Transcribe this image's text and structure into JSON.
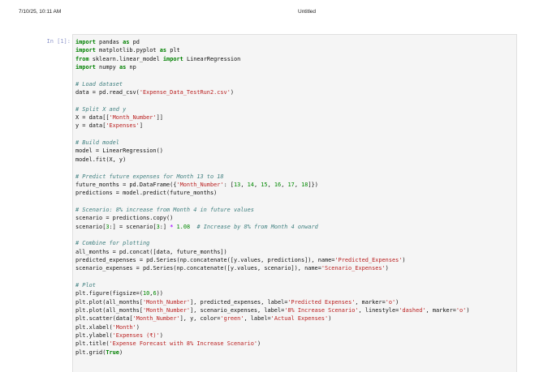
{
  "print_header": {
    "date": "7/10/25, 10:11 AM",
    "title": "Untitled"
  },
  "cell": {
    "prompt": "In [1]:",
    "language": "python",
    "lines": [
      [
        {
          "t": "import",
          "c": "kw"
        },
        {
          "t": " pandas "
        },
        {
          "t": "as",
          "c": "kw"
        },
        {
          "t": " pd"
        }
      ],
      [
        {
          "t": "import",
          "c": "kw"
        },
        {
          "t": " matplotlib.pyplot "
        },
        {
          "t": "as",
          "c": "kw"
        },
        {
          "t": " plt"
        }
      ],
      [
        {
          "t": "from",
          "c": "kw"
        },
        {
          "t": " sklearn.linear_model "
        },
        {
          "t": "import",
          "c": "kw"
        },
        {
          "t": " LinearRegression"
        }
      ],
      [
        {
          "t": "import",
          "c": "kw"
        },
        {
          "t": " numpy "
        },
        {
          "t": "as",
          "c": "kw"
        },
        {
          "t": " np"
        }
      ],
      [],
      [
        {
          "t": "# Load dataset",
          "c": "cm"
        }
      ],
      [
        {
          "t": "data = pd.read_csv("
        },
        {
          "t": "'Expense_Data_TestRun2.csv'",
          "c": "st"
        },
        {
          "t": ")"
        }
      ],
      [],
      [
        {
          "t": "# Split X and y",
          "c": "cm"
        }
      ],
      [
        {
          "t": "X = data[["
        },
        {
          "t": "'Month_Number'",
          "c": "st"
        },
        {
          "t": "]]"
        }
      ],
      [
        {
          "t": "y = data["
        },
        {
          "t": "'Expenses'",
          "c": "st"
        },
        {
          "t": "]"
        }
      ],
      [],
      [
        {
          "t": "# Build model",
          "c": "cm"
        }
      ],
      [
        {
          "t": "model = LinearRegression()"
        }
      ],
      [
        {
          "t": "model.fit(X, y)"
        }
      ],
      [],
      [
        {
          "t": "# Predict future expenses for Month 13 to 18",
          "c": "cm"
        }
      ],
      [
        {
          "t": "future_months = pd.DataFrame({"
        },
        {
          "t": "'Month_Number'",
          "c": "st"
        },
        {
          "t": ": ["
        },
        {
          "t": "13",
          "c": "nu"
        },
        {
          "t": ", "
        },
        {
          "t": "14",
          "c": "nu"
        },
        {
          "t": ", "
        },
        {
          "t": "15",
          "c": "nu"
        },
        {
          "t": ", "
        },
        {
          "t": "16",
          "c": "nu"
        },
        {
          "t": ", "
        },
        {
          "t": "17",
          "c": "nu"
        },
        {
          "t": ", "
        },
        {
          "t": "18",
          "c": "nu"
        },
        {
          "t": "]})"
        }
      ],
      [
        {
          "t": "predictions = model.predict(future_months)"
        }
      ],
      [],
      [
        {
          "t": "# Scenario: 8% increase from Month 4 in future values",
          "c": "cm"
        }
      ],
      [
        {
          "t": "scenario = predictions.copy()"
        }
      ],
      [
        {
          "t": "scenario["
        },
        {
          "t": "3",
          "c": "nu"
        },
        {
          "t": ":] = scenario["
        },
        {
          "t": "3",
          "c": "nu"
        },
        {
          "t": ":] "
        },
        {
          "t": "*",
          "c": "op"
        },
        {
          "t": " "
        },
        {
          "t": "1.08",
          "c": "nu"
        },
        {
          "t": "  "
        },
        {
          "t": "# Increase by 8% from Month 4 onward",
          "c": "cm"
        }
      ],
      [],
      [
        {
          "t": "# Combine for plotting",
          "c": "cm"
        }
      ],
      [
        {
          "t": "all_months = pd.concat([data, future_months])"
        }
      ],
      [
        {
          "t": "predicted_expenses = pd.Series(np.concatenate([y.values, predictions]), name="
        },
        {
          "t": "'Predicted_Expenses'",
          "c": "st"
        },
        {
          "t": ")"
        }
      ],
      [
        {
          "t": "scenario_expenses = pd.Series(np.concatenate([y.values, scenario]), name="
        },
        {
          "t": "'Scenario_Expenses'",
          "c": "st"
        },
        {
          "t": ")"
        }
      ],
      [],
      [
        {
          "t": "# Plot",
          "c": "cm"
        }
      ],
      [
        {
          "t": "plt.figure(figsize=("
        },
        {
          "t": "10",
          "c": "nu"
        },
        {
          "t": ","
        },
        {
          "t": "6",
          "c": "nu"
        },
        {
          "t": "))"
        }
      ],
      [
        {
          "t": "plt.plot(all_months["
        },
        {
          "t": "'Month_Number'",
          "c": "st"
        },
        {
          "t": "], predicted_expenses, label="
        },
        {
          "t": "'Predicted Expenses'",
          "c": "st"
        },
        {
          "t": ", marker="
        },
        {
          "t": "'o'",
          "c": "st"
        },
        {
          "t": ")"
        }
      ],
      [
        {
          "t": "plt.plot(all_months["
        },
        {
          "t": "'Month_Number'",
          "c": "st"
        },
        {
          "t": "], scenario_expenses, label="
        },
        {
          "t": "'8% Increase Scenario'",
          "c": "st"
        },
        {
          "t": ", linestyle="
        },
        {
          "t": "'dashed'",
          "c": "st"
        },
        {
          "t": ", marker="
        },
        {
          "t": "'o'",
          "c": "st"
        },
        {
          "t": ")"
        }
      ],
      [
        {
          "t": "plt.scatter(data["
        },
        {
          "t": "'Month_Number'",
          "c": "st"
        },
        {
          "t": "], y, color="
        },
        {
          "t": "'green'",
          "c": "st"
        },
        {
          "t": ", label="
        },
        {
          "t": "'Actual Expenses'",
          "c": "st"
        },
        {
          "t": ")"
        }
      ],
      [
        {
          "t": "plt.xlabel("
        },
        {
          "t": "'Month'",
          "c": "st"
        },
        {
          "t": ")"
        }
      ],
      [
        {
          "t": "plt.ylabel("
        },
        {
          "t": "'Expenses (₹)'",
          "c": "st"
        },
        {
          "t": ")"
        }
      ],
      [
        {
          "t": "plt.title("
        },
        {
          "t": "'Expense Forecast with 8% Increase Scenario'",
          "c": "st"
        },
        {
          "t": ")"
        }
      ],
      [
        {
          "t": "plt.grid("
        },
        {
          "t": "True",
          "c": "cn"
        },
        {
          "t": ")"
        }
      ]
    ]
  },
  "colors": {
    "keyword": "#008000",
    "comment": "#408080",
    "string": "#ba2121",
    "prompt": "#303f9f",
    "cell_background": "#f5f5f5"
  }
}
